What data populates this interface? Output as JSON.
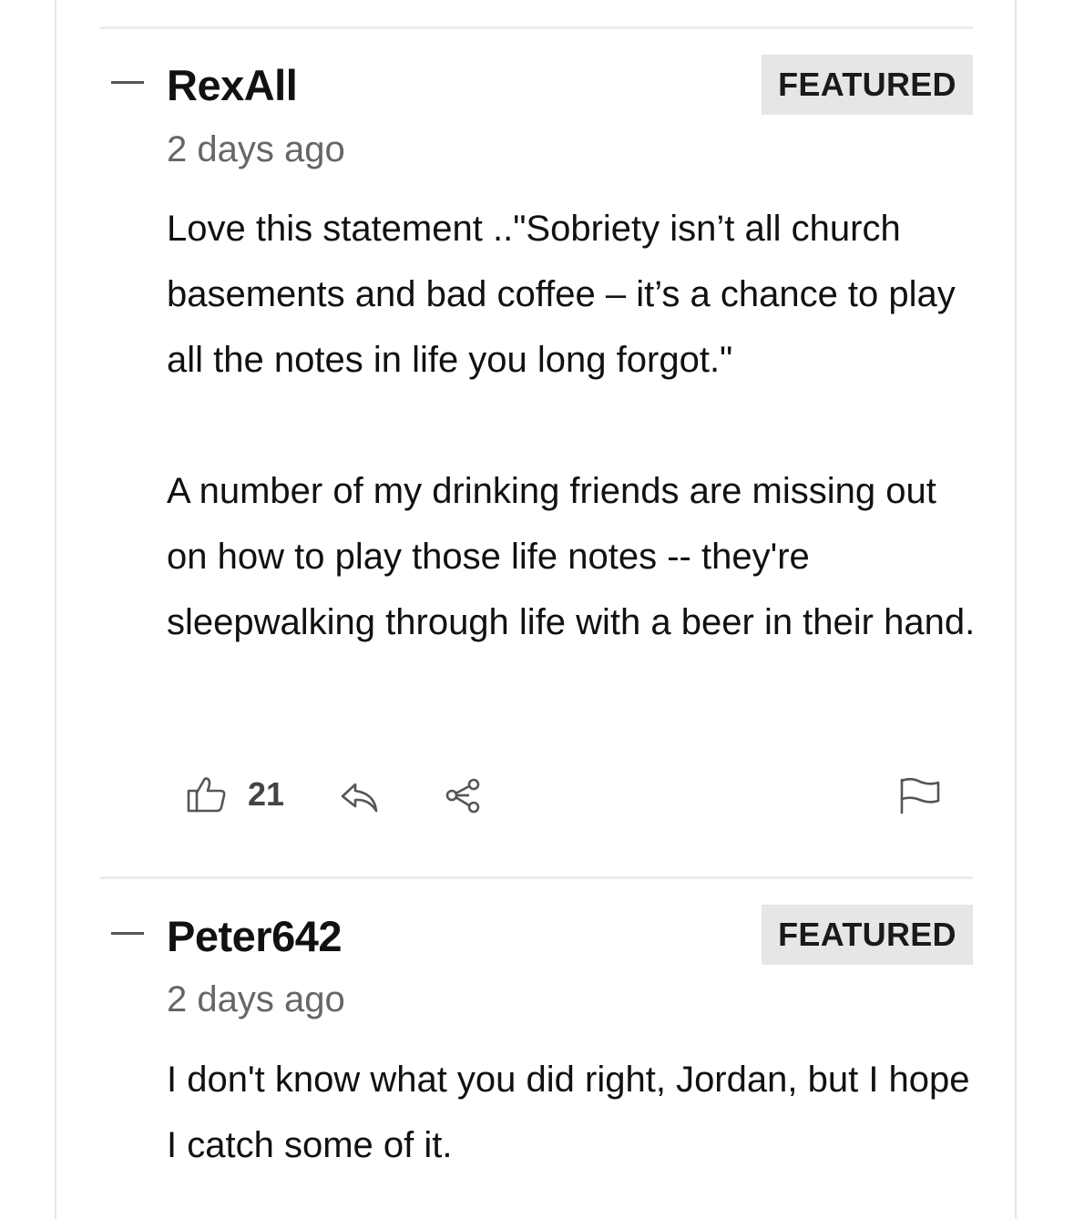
{
  "comments": [
    {
      "author": "RexAll",
      "badge": "FEATURED",
      "timestamp": "2 days ago",
      "paragraphs": [
        "Love this statement ..\"Sobriety isn’t all church basements and bad coffee – it’s a chance to play all the notes in life you long forgot.\"",
        "A number of my drinking friends are missing out on how to play those life notes -- they're sleepwalking through life with a beer in their hand."
      ],
      "likes": "21"
    },
    {
      "author": "Peter642",
      "badge": "FEATURED",
      "timestamp": "2 days ago",
      "paragraphs": [
        "I don't know what you did right, Jordan, but I hope I catch some of it."
      ]
    }
  ],
  "icons": {
    "collapse": "minus-icon",
    "like": "thumbs-up-icon",
    "reply": "reply-arrow-icon",
    "share": "share-nodes-icon",
    "report": "flag-icon"
  },
  "colors": {
    "badge_bg": "#e6e6e6",
    "divider": "#ececec",
    "timestamp": "#666666",
    "icon": "#555555"
  }
}
